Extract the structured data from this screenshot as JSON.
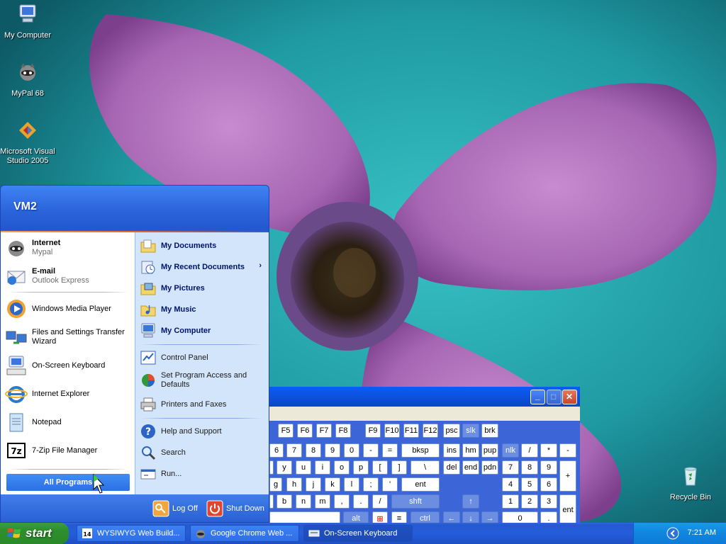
{
  "desktop": {
    "icons": [
      {
        "label": "My Computer"
      },
      {
        "label": "MyPal 68"
      },
      {
        "label": "Microsoft Visual Studio 2005"
      },
      {
        "label": "Recycle Bin"
      }
    ]
  },
  "start_menu": {
    "user": "VM2",
    "left": [
      {
        "main": "Internet",
        "sub": "Mypal"
      },
      {
        "main": "E-mail",
        "sub": "Outlook Express"
      },
      {
        "label": "Windows Media Player"
      },
      {
        "label": "Files and Settings Transfer Wizard"
      },
      {
        "label": "On-Screen Keyboard"
      },
      {
        "label": "Internet Explorer"
      },
      {
        "label": "Notepad"
      },
      {
        "label": "7-Zip File Manager"
      }
    ],
    "all_programs": "All Programs",
    "right": [
      {
        "label": "My Documents"
      },
      {
        "label": "My Recent Documents"
      },
      {
        "label": "My Pictures"
      },
      {
        "label": "My Music"
      },
      {
        "label": "My Computer"
      },
      {
        "label": "Control Panel"
      },
      {
        "label": "Set Program Access and Defaults"
      },
      {
        "label": "Printers and Faxes"
      },
      {
        "label": "Help and Support"
      },
      {
        "label": "Search"
      },
      {
        "label": "Run..."
      }
    ],
    "log_off": "Log Off",
    "shut_down": "Shut Down",
    "submenu_arrow": "›"
  },
  "osk": {
    "row_f": [
      "F5",
      "F6",
      "F7",
      "F8",
      "F9",
      "F10",
      "F11",
      "F12",
      "psc",
      "slk",
      "brk"
    ],
    "row_num": [
      "6",
      "7",
      "8",
      "9",
      "0",
      "-",
      "=",
      "bksp",
      "ins",
      "hm",
      "pup",
      "nlk",
      "/",
      "*",
      "-"
    ],
    "row_top": [
      "y",
      "u",
      "i",
      "o",
      "p",
      "[",
      "]",
      "\\",
      "del",
      "end",
      "pdn",
      "7",
      "8",
      "9",
      "+"
    ],
    "row_mid": [
      "h",
      "j",
      "k",
      "l",
      ";",
      "'",
      "ent",
      "4",
      "5",
      "6"
    ],
    "row_bot": [
      "b",
      "n",
      "m",
      ",",
      ".",
      "/",
      "shft",
      "↑",
      "1",
      "2",
      "3",
      "ent"
    ],
    "row_space": [
      "alt",
      "ctrl",
      "←",
      "↓",
      "→",
      "0",
      "."
    ],
    "row_g": "g",
    "win_glyph": "⊞",
    "menu_glyph": "≡",
    "minimize": "_",
    "maximize": "□",
    "close": "✕"
  },
  "taskbar": {
    "start": "start",
    "tasks": [
      {
        "label": "WYSIWYG Web Build..."
      },
      {
        "label": "Google Chrome Web ..."
      },
      {
        "label": "On-Screen Keyboard"
      }
    ],
    "clock": "7:21 AM",
    "help_glyph": "?"
  },
  "colors": {
    "start_blue": "#2b5dd1",
    "start_green": "#2d8e2d",
    "taskbar_blue": "#245ddb",
    "tray_blue": "#0f86de"
  }
}
